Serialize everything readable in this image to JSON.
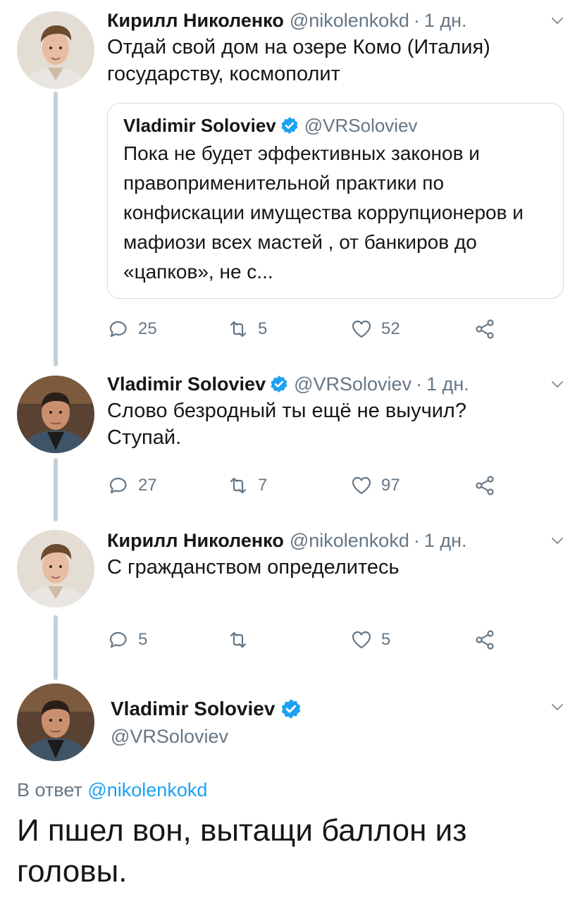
{
  "tweets": [
    {
      "name": "Кирилл Николенко",
      "handle": "@nikolenkokd",
      "time": "1 дн.",
      "text": "Отдай свой дом на озере Комо (Италия) государству, космополит",
      "quote": {
        "name": "Vladimir Soloviev",
        "handle": "@VRSoloviev",
        "text": "Пока не будет эффективных законов и правоприменительной практики по конфискации имущества коррупционеров и мафиози всех мастей , от банкиров до «цапков», не с..."
      },
      "replies": "25",
      "retweets": "5",
      "likes": "52"
    },
    {
      "name": "Vladimir Soloviev",
      "handle": "@VRSoloviev",
      "time": "1 дн.",
      "text": "Слово безродный ты ещё не выучил? Ступай.",
      "replies": "27",
      "retweets": "7",
      "likes": "97"
    },
    {
      "name": "Кирилл Николенко",
      "handle": "@nikolenkokd",
      "time": "1 дн.",
      "text": "С гражданством определитесь",
      "replies": "5",
      "retweets": "",
      "likes": "5"
    }
  ],
  "main_tweet": {
    "name": "Vladimir Soloviev",
    "handle": "@VRSoloviev",
    "reply_prefix": "В ответ",
    "reply_handle": "@nikolenkokd",
    "text": "И пшел вон, вытащи баллон из головы."
  },
  "separator": "·",
  "colors": {
    "accent": "#1da1f2",
    "secondary_text": "#657786",
    "thread_line": "#c4cfd6"
  },
  "icons": [
    "reply-icon",
    "retweet-icon",
    "like-icon",
    "share-icon",
    "verified-badge-icon",
    "chevron-down-icon"
  ]
}
